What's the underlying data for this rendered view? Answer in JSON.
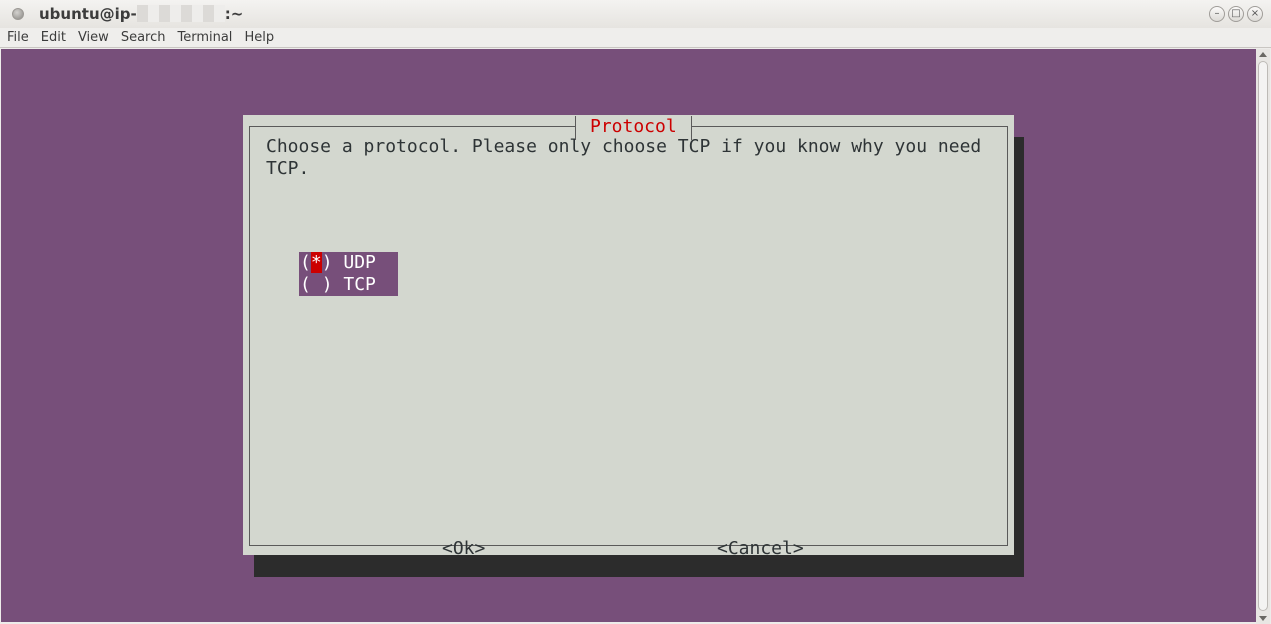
{
  "window": {
    "title_prefix": "ubuntu@ip-",
    "title_suffix": ":~",
    "buttons": {
      "minimize": "–",
      "maximize": "□",
      "close": "×"
    }
  },
  "menu": [
    "File",
    "Edit",
    "View",
    "Search",
    "Terminal",
    "Help"
  ],
  "dialog": {
    "title": "Protocol",
    "prompt_line1": "Choose a protocol. Please only choose TCP if you know why you need",
    "prompt_line2": "TCP.",
    "options": [
      {
        "open": "(",
        "mark": "*",
        "close": ") ",
        "label": "UDP",
        "selected": true
      },
      {
        "open": "(",
        "mark": " ",
        "close": ") ",
        "label": "TCP",
        "selected": false
      }
    ],
    "ok_label": "<Ok>",
    "cancel_label": "<Cancel>"
  },
  "colors": {
    "terminal_bg": "#774f7a",
    "dialog_bg": "#d3d7cf",
    "title_red": "#cc0000",
    "shadow": "#2c2c2c"
  }
}
